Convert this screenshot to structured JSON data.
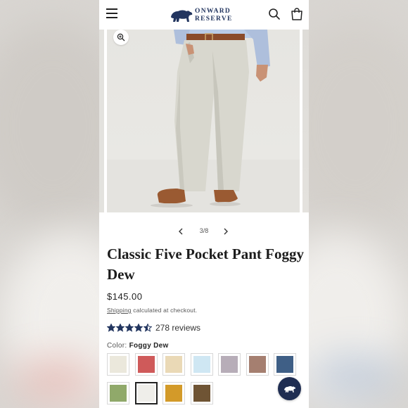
{
  "brand": {
    "line1": "ONWARD",
    "line2": "RESERVE",
    "color": "#22355f"
  },
  "icons": {
    "menu": "hamburger-menu-icon",
    "search": "search-icon",
    "cart": "shopping-bag-icon",
    "zoom": "zoom-in-icon",
    "prev": "chevron-left-icon",
    "next": "chevron-right-icon",
    "chat": "bear-chat-icon"
  },
  "gallery": {
    "counter": "3/8"
  },
  "product": {
    "title": "Classic Five Pocket Pant Foggy Dew",
    "price": "$145.00",
    "shipping_link": "Shipping",
    "shipping_text": " calculated at checkout.",
    "rating": 4.5,
    "star_color": "#22355f",
    "reviews": "278 reviews",
    "color_label": "Color: ",
    "color_value": "Foggy Dew"
  },
  "swatches": [
    {
      "color": "#ebe8dc",
      "selected": false
    },
    {
      "color": "#cf5a5a",
      "selected": false
    },
    {
      "color": "#ead9b6",
      "selected": false
    },
    {
      "color": "#cfe7f3",
      "selected": false
    },
    {
      "color": "#b7adb8",
      "selected": false
    },
    {
      "color": "#a57f70",
      "selected": false
    },
    {
      "color": "#3f5f86",
      "selected": false
    },
    {
      "color": "#90a96a",
      "selected": false
    },
    {
      "color": "#efeeea",
      "selected": true
    },
    {
      "color": "#d39a29",
      "selected": false
    },
    {
      "color": "#6f5434",
      "selected": false
    }
  ]
}
